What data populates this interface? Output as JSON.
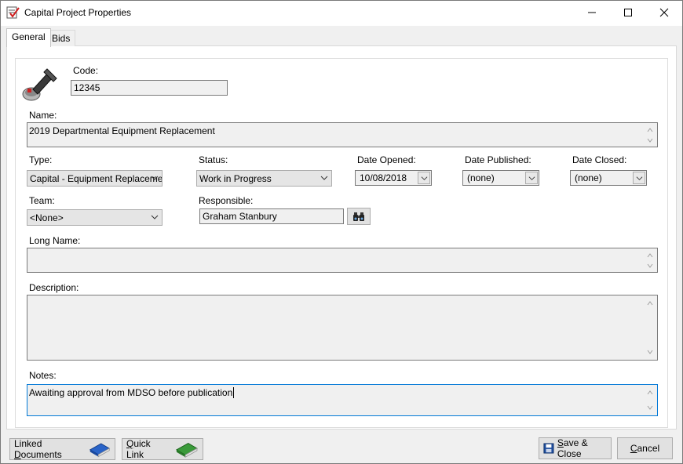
{
  "window": {
    "title": "Capital Project Properties"
  },
  "tabs": [
    {
      "label": "General"
    },
    {
      "label": "Bids"
    }
  ],
  "form": {
    "code_label": "Code:",
    "code_value": "12345",
    "name_label": "Name:",
    "name_value": "2019 Departmental Equipment Replacement",
    "type_label": "Type:",
    "type_value": "Capital - Equipment Replacement",
    "status_label": "Status:",
    "status_value": "Work in Progress",
    "date_opened_label": "Date Opened:",
    "date_opened_value": "10/08/2018",
    "date_published_label": "Date Published:",
    "date_published_value": "(none)",
    "date_closed_label": "Date Closed:",
    "date_closed_value": "(none)",
    "team_label": "Team:",
    "team_value": "<None>",
    "responsible_label": "Responsible:",
    "responsible_value": "Graham Stanbury",
    "long_name_label": "Long Name:",
    "long_name_value": "",
    "description_label": "Description:",
    "description_value": "",
    "notes_label": "Notes:",
    "notes_value": "Awaiting approval from MDSO before publication"
  },
  "buttons": {
    "linked_docs_pre": "Linked ",
    "linked_docs_u": "D",
    "linked_docs_post": "ocuments",
    "quick_link_u": "Q",
    "quick_link_post": "uick Link",
    "save_u": "S",
    "save_post": "ave & Close",
    "cancel_u": "C",
    "cancel_post": "ancel"
  },
  "colors": {
    "accent": "#0078d7",
    "book_blue": "#2a64c8",
    "book_green": "#3a9a3a"
  }
}
